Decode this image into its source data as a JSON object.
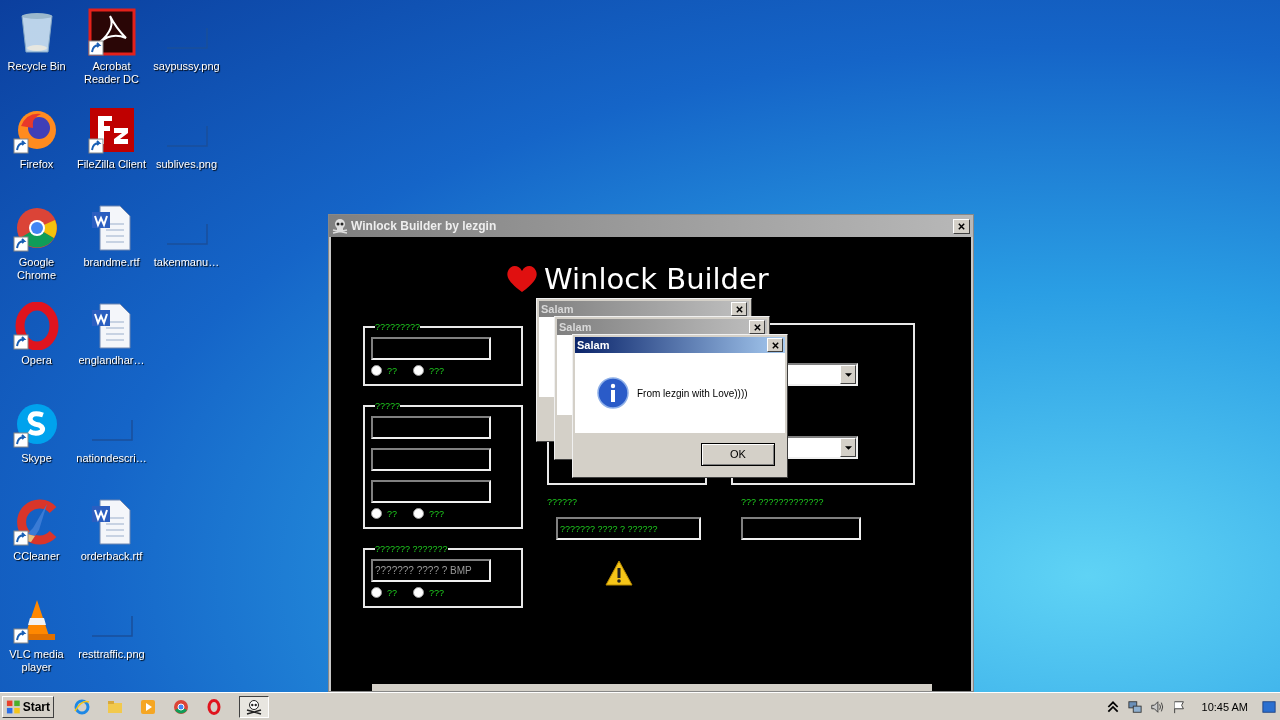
{
  "desktop_icons": [
    {
      "label": "Recycle Bin",
      "kind": "recycle",
      "shortcut": false
    },
    {
      "label": "Firefox",
      "kind": "firefox",
      "shortcut": true
    },
    {
      "label": "Google Chrome",
      "kind": "chrome",
      "shortcut": true
    },
    {
      "label": "Opera",
      "kind": "opera",
      "shortcut": true
    },
    {
      "label": "Skype",
      "kind": "skype",
      "shortcut": true
    },
    {
      "label": "CCleaner",
      "kind": "ccleaner",
      "shortcut": true
    },
    {
      "label": "VLC media player",
      "kind": "vlc",
      "shortcut": true
    },
    {
      "label": "Acrobat Reader DC",
      "kind": "acrobat",
      "shortcut": true
    },
    {
      "label": "FileZilla Client",
      "kind": "filezilla",
      "shortcut": true
    },
    {
      "label": "brandme.rtf",
      "kind": "word",
      "shortcut": false
    },
    {
      "label": "englandhar…",
      "kind": "word",
      "shortcut": false
    },
    {
      "label": "nationdescri…",
      "kind": "image",
      "shortcut": false
    },
    {
      "label": "orderback.rtf",
      "kind": "word",
      "shortcut": false
    },
    {
      "label": "resttraffic.png",
      "kind": "image",
      "shortcut": false
    },
    {
      "label": "saypussy.png",
      "kind": "image",
      "shortcut": false
    },
    {
      "label": "sublives.png",
      "kind": "image",
      "shortcut": false
    },
    {
      "label": "takenmanu…",
      "kind": "image",
      "shortcut": false
    }
  ],
  "window": {
    "title": "Winlock Builder by lezgin",
    "heading": "Winlock Builder",
    "left_groups": [
      {
        "legend": "?????????",
        "fields": [
          {
            "kind": "text"
          }
        ],
        "radios": [
          {
            "label": "??",
            "selected": false
          },
          {
            "label": "???",
            "selected": false
          }
        ]
      },
      {
        "legend": "?????",
        "fields": [
          {
            "kind": "text"
          },
          {
            "kind": "text"
          },
          {
            "kind": "text"
          }
        ],
        "radios": [
          {
            "label": "??",
            "selected": false
          },
          {
            "label": "???",
            "selected": false
          }
        ]
      },
      {
        "legend": "??????? ???????",
        "fields": [
          {
            "kind": "text",
            "placeholder": "??????? ???? ? BMP"
          }
        ],
        "radios": [
          {
            "label": "??",
            "selected": false
          },
          {
            "label": "???",
            "selected": false
          }
        ]
      }
    ],
    "right_group": {
      "fields": [
        {
          "kind": "combo"
        },
        {
          "kind": "combo"
        }
      ]
    },
    "bottom_fields": [
      {
        "label": "??????",
        "value": "??????? ???? ? ??????"
      },
      {
        "label": "??? ?????????????"
      }
    ]
  },
  "dialogs": [
    {
      "title": "Salam",
      "active": false
    },
    {
      "title": "Salam",
      "active": false
    },
    {
      "title": "Salam",
      "active": true,
      "message": "From lezgin with Love))))",
      "button": "OK"
    }
  ],
  "taskbar": {
    "start": "Start",
    "items": [
      {
        "kind": "ie",
        "active": false
      },
      {
        "kind": "folder",
        "active": false
      },
      {
        "kind": "media",
        "active": false
      },
      {
        "kind": "chrome",
        "active": false
      },
      {
        "kind": "opera",
        "active": false
      },
      {
        "kind": "skull",
        "active": true
      }
    ],
    "time": "10:45 AM"
  }
}
